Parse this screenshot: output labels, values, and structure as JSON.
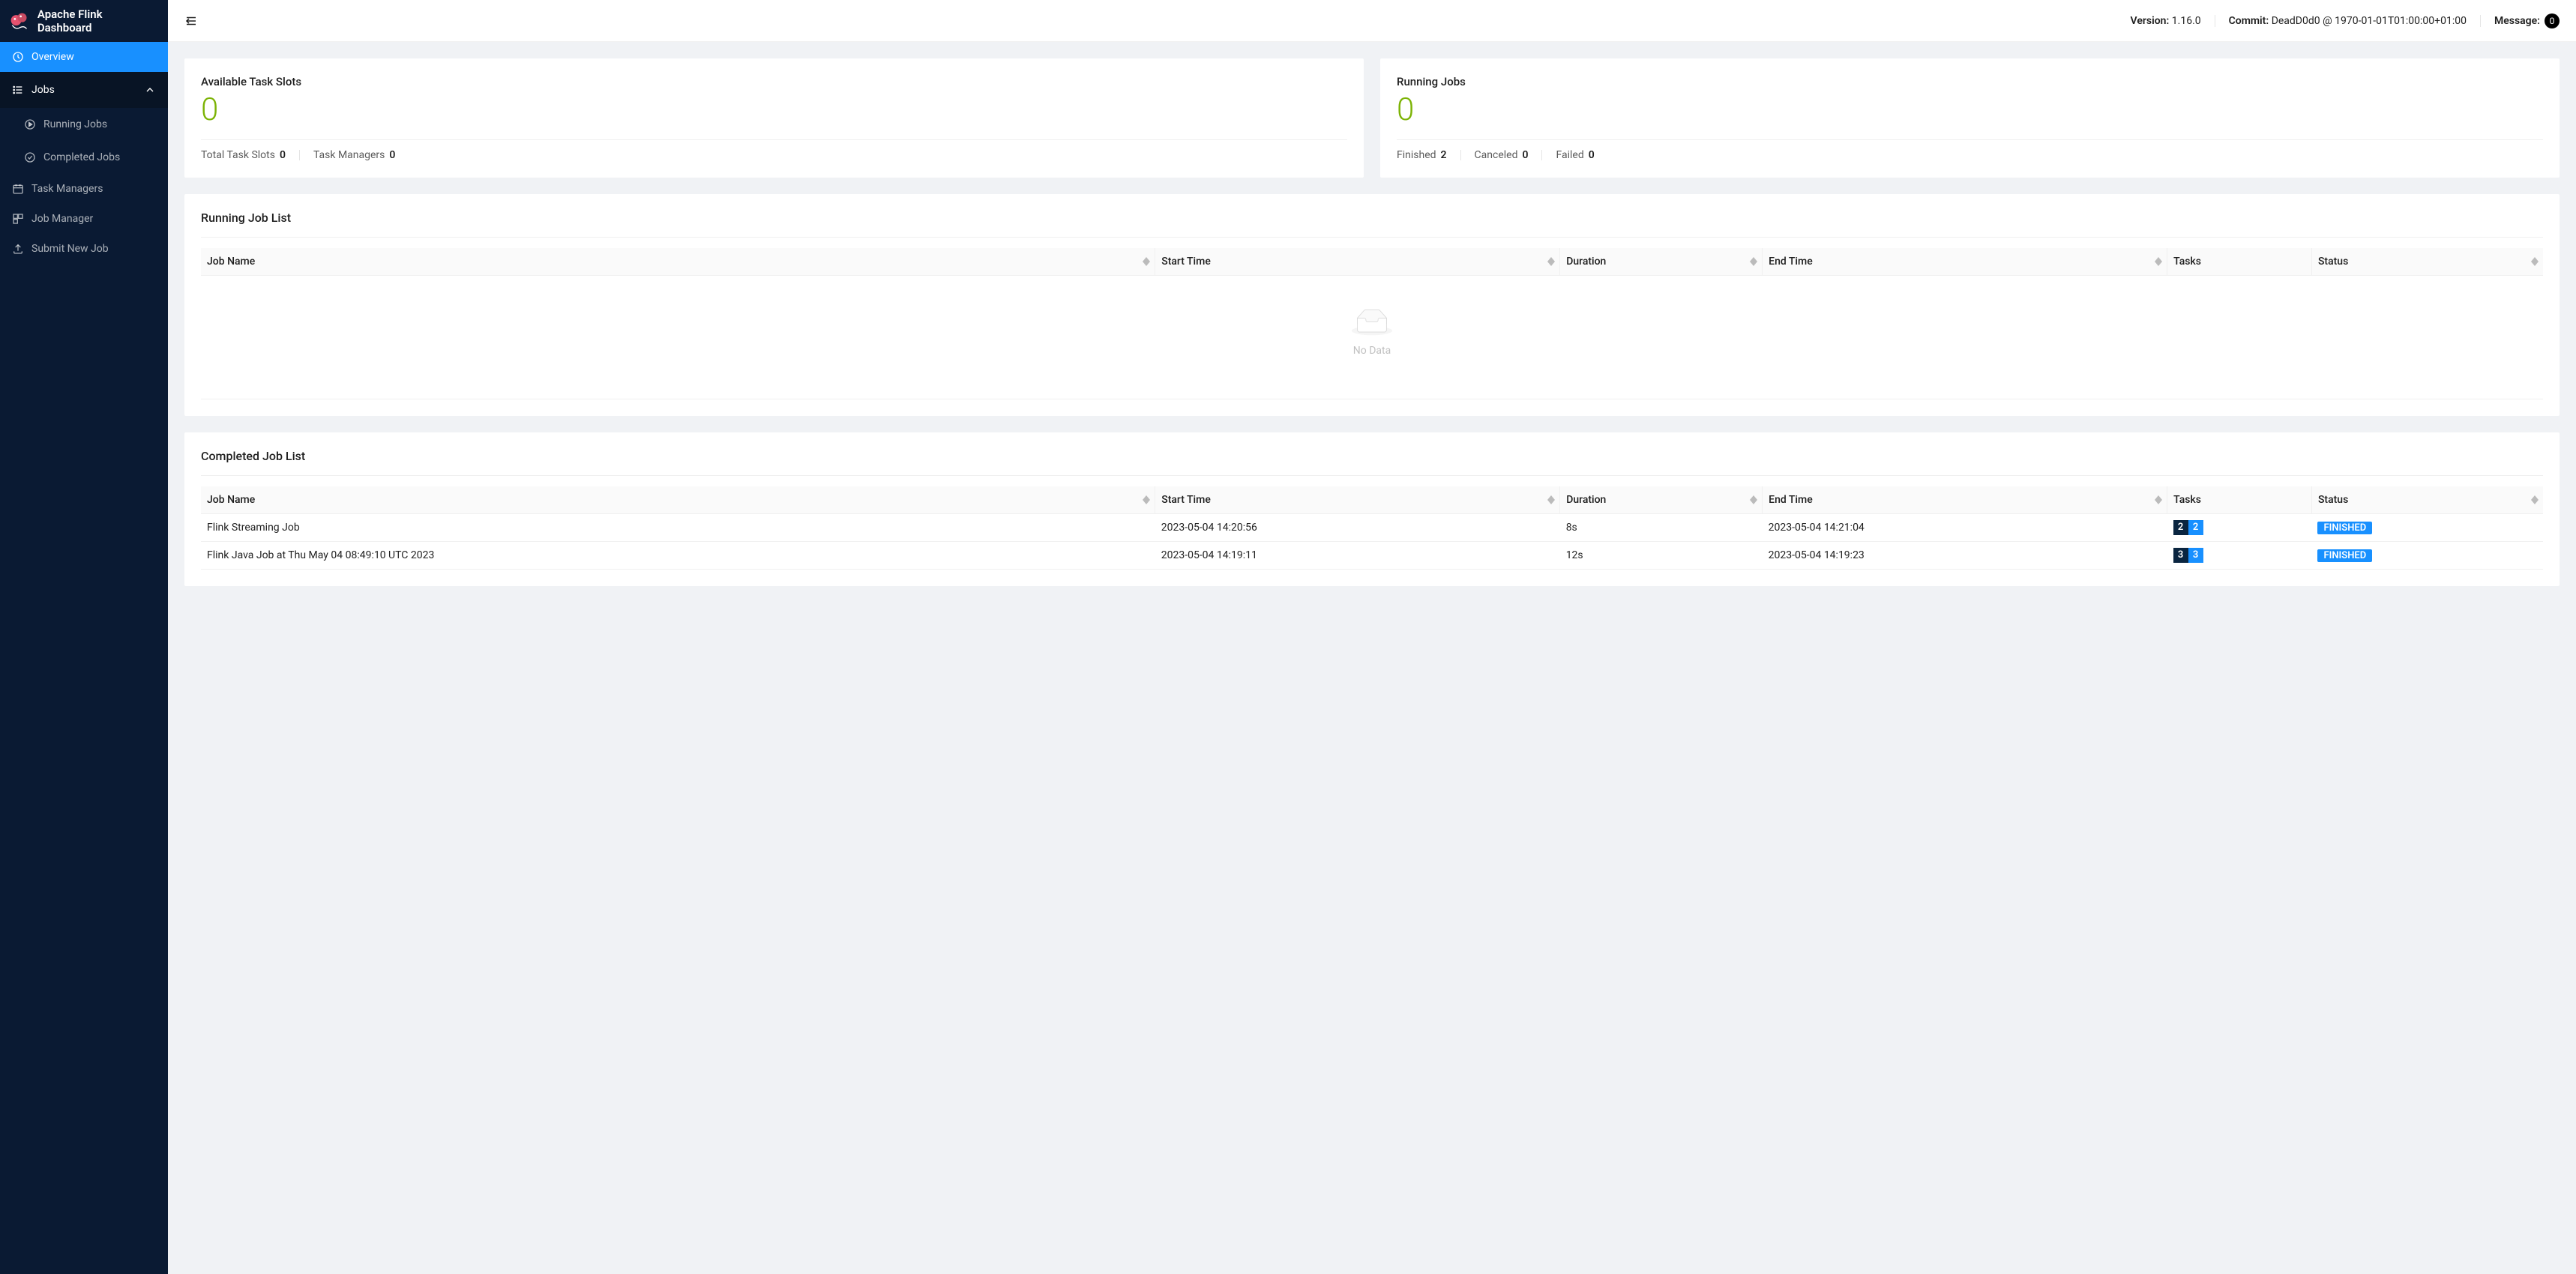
{
  "brand": {
    "title": "Apache Flink Dashboard"
  },
  "sidebar": {
    "overview": "Overview",
    "jobs": "Jobs",
    "running_jobs": "Running Jobs",
    "completed_jobs": "Completed Jobs",
    "task_managers": "Task Managers",
    "job_manager": "Job Manager",
    "submit": "Submit New Job"
  },
  "topbar": {
    "version_label": "Version:",
    "version_value": "1.16.0",
    "commit_label": "Commit:",
    "commit_value": "DeadD0d0 @ 1970-01-01T01:00:00+01:00",
    "message_label": "Message:",
    "message_count": "0"
  },
  "slots_card": {
    "title": "Available Task Slots",
    "value": "0",
    "total_label": "Total Task Slots",
    "total_value": "0",
    "tm_label": "Task Managers",
    "tm_value": "0"
  },
  "jobs_card": {
    "title": "Running Jobs",
    "value": "0",
    "finished_label": "Finished",
    "finished_value": "2",
    "canceled_label": "Canceled",
    "canceled_value": "0",
    "failed_label": "Failed",
    "failed_value": "0"
  },
  "running_list": {
    "title": "Running Job List",
    "cols": {
      "name": "Job Name",
      "start": "Start Time",
      "duration": "Duration",
      "end": "End Time",
      "tasks": "Tasks",
      "status": "Status"
    },
    "empty": "No Data"
  },
  "completed_list": {
    "title": "Completed Job List",
    "cols": {
      "name": "Job Name",
      "start": "Start Time",
      "duration": "Duration",
      "end": "End Time",
      "tasks": "Tasks",
      "status": "Status"
    },
    "rows": [
      {
        "name": "Flink Streaming Job",
        "start": "2023-05-04 14:20:56",
        "duration": "8s",
        "end": "2023-05-04 14:21:04",
        "tasks_a": "2",
        "tasks_b": "2",
        "status": "FINISHED"
      },
      {
        "name": "Flink Java Job at Thu May 04 08:49:10 UTC 2023",
        "start": "2023-05-04 14:19:11",
        "duration": "12s",
        "end": "2023-05-04 14:19:23",
        "tasks_a": "3",
        "tasks_b": "3",
        "status": "FINISHED"
      }
    ]
  }
}
